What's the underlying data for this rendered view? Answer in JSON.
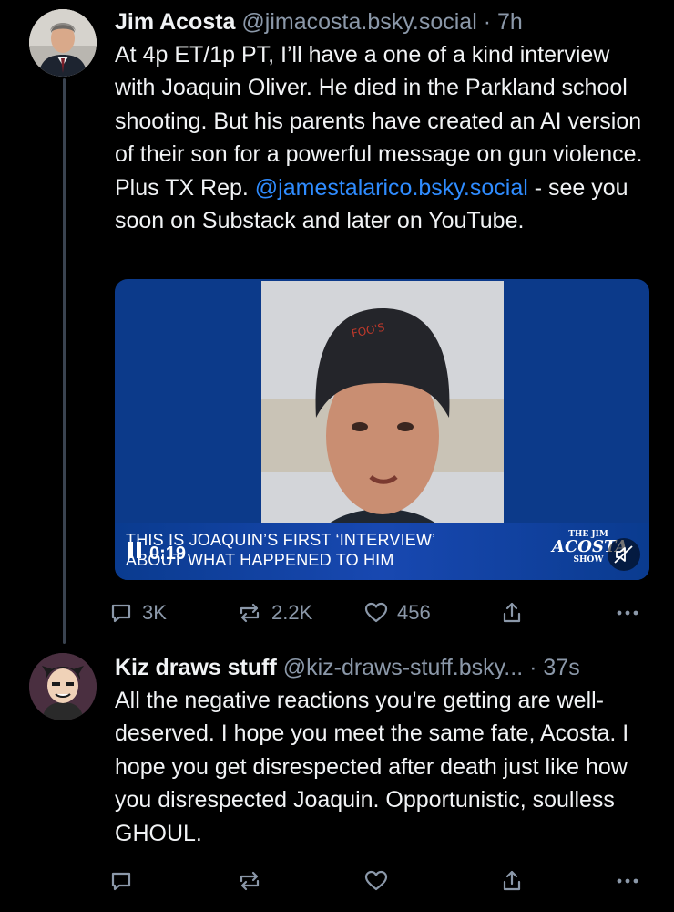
{
  "posts": [
    {
      "author_name": "Jim Acosta",
      "handle": "@jimacosta.bsky.social",
      "time": "· 7h",
      "text_before": "At 4p ET/1p PT, I’ll have a one of a kind interview with Joaquin Oliver. He died in the Parkland school shooting. But his parents have created an AI version of their son for a powerful message on gun violence. Plus TX Rep. ",
      "mention": "@jamestalarico.bsky.social",
      "text_after": " - see you soon on Substack and later on YouTube.",
      "video": {
        "caption_line1": "This is Joaquin’s first ‘interview’",
        "caption_line2": "about what happened to him",
        "timecode": "0:19",
        "show_logo_top": "THE JIM",
        "show_logo_main": "ACOSTA",
        "show_logo_bottom": "SHOW",
        "hat_text": "FOO'S"
      },
      "replies": "3K",
      "reposts": "2.2K",
      "likes": "456"
    },
    {
      "author_name": "Kiz draws stuff",
      "handle": "@kiz-draws-stuff.bsky...",
      "time": "· 37s",
      "text": "All the negative reactions you're getting are well-deserved. I hope you meet the same fate, Acosta. I hope you get disrespected after death just like how you disrespected Joaquin. Opportunistic, soulless GHOUL.",
      "replies": "",
      "reposts": "",
      "likes": ""
    }
  ],
  "icons": {
    "reply": "reply-icon",
    "repost": "repost-icon",
    "like": "heart-icon",
    "share": "share-icon",
    "more": "more-icon",
    "pause": "pause-icon",
    "mute": "mute-icon"
  },
  "colors": {
    "background": "#000000",
    "text": "#f1f3f5",
    "muted": "#8b98a9",
    "link": "#2f8cff",
    "thread_line": "#3a4350",
    "video_bg": "#0c3a8a"
  }
}
